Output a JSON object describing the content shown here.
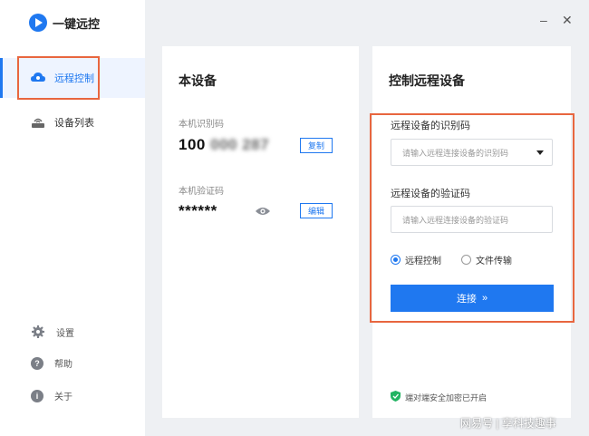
{
  "app": {
    "name": "一键远控"
  },
  "window": {
    "minimize": "–",
    "close": "✕"
  },
  "nav": {
    "items": [
      {
        "label": "远程控制",
        "icon": "remote-control-icon"
      },
      {
        "label": "设备列表",
        "icon": "device-list-icon"
      }
    ],
    "bottom": [
      {
        "label": "设置",
        "icon": "gear-icon"
      },
      {
        "label": "帮助",
        "icon": "help-icon"
      },
      {
        "label": "关于",
        "icon": "info-icon"
      }
    ]
  },
  "device": {
    "title": "本设备",
    "id_label": "本机识别码",
    "id_prefix": "100",
    "id_hidden": "000 287",
    "copy_label": "复制",
    "code_label": "本机验证码",
    "code_value": "******",
    "edit_label": "编辑"
  },
  "remote": {
    "title": "控制远程设备",
    "id_label": "远程设备的识别码",
    "id_placeholder": "请输入远程连接设备的识别码",
    "code_label": "远程设备的验证码",
    "code_placeholder": "请输入远程连接设备的验证码",
    "options": [
      "远程控制",
      "文件传输"
    ],
    "selected_option": "远程控制",
    "connect_label": "连接",
    "connect_arrows": "»",
    "secure_text": "端对端安全加密已开启"
  },
  "watermark": "网易号 | 享科技趣事",
  "colors": {
    "accent": "#1f78f0",
    "highlight": "#e8663f",
    "secure": "#23b463"
  }
}
